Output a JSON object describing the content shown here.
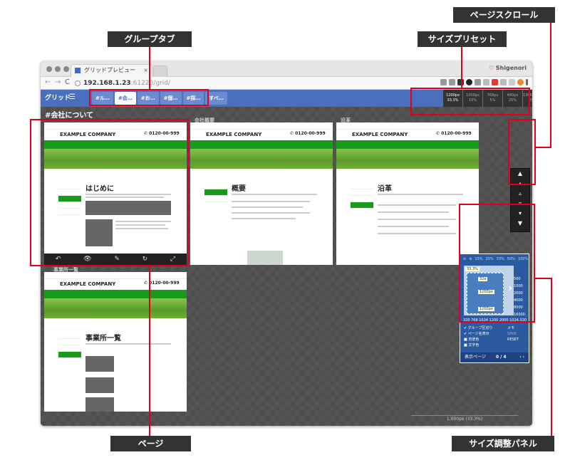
{
  "callouts": {
    "group_tab": "グループタブ",
    "size_preset": "サイズプリセット",
    "page_scroll": "ページスクロール",
    "page": "ページ",
    "size_panel": "サイズ調整パネル"
  },
  "browser": {
    "tab_title": "グリッドプレビュー",
    "tab_close": "×",
    "user": "Shigenori",
    "url_host": "192.168.1.23",
    "url_rest": ":61220/grid/",
    "back": "←",
    "forward": "→",
    "reload": "C"
  },
  "toolbar": {
    "grid_label": "グリッド",
    "list_icon": "☰",
    "group_tabs": [
      "#ル…",
      "#会…",
      "#お…",
      "#個…",
      "#採…",
      "すべ…"
    ],
    "active_group_index": 1,
    "presets": [
      {
        "label": "1200px",
        "sub": "33.3%"
      },
      {
        "label": "1000px",
        "sub": "15%"
      },
      {
        "label": "768px",
        "sub": "5%"
      },
      {
        "label": "480px",
        "sub": "25%"
      },
      {
        "label": "1366,320px",
        "sub": "25%"
      }
    ]
  },
  "section_title": "#会社について",
  "pages": [
    {
      "title": "",
      "heading": "はじめに"
    },
    {
      "title": "会社概要",
      "heading": "概要"
    },
    {
      "title": "沿革",
      "heading": "沿革"
    },
    {
      "title": "事業所一覧",
      "heading": "事業所一覧"
    }
  ],
  "company_name": "EXAMPLE COMPANY",
  "phone": "0120-00-999",
  "page_actions": [
    "↶",
    "👁",
    "✎",
    "↻",
    "⤢"
  ],
  "scroll_buttons": [
    "▲",
    "▴",
    "▵",
    "▿",
    "▾",
    "▼"
  ],
  "panel": {
    "zooms": [
      "15%",
      "25%",
      "33%",
      "50%",
      "100%"
    ],
    "ysizes": [
      "500",
      "1000",
      "2000",
      "4000",
      "8000",
      "16000"
    ],
    "xsizes": [
      "320",
      "768",
      "1024",
      "1200",
      "2000",
      "1024,320"
    ],
    "width_label": "1200px",
    "height_label": "1200px",
    "side_label": "32e",
    "zoom_label": "33.3%",
    "options": [
      "グループ区切り",
      "ページ名表示",
      "背景色",
      "文字色"
    ],
    "memo": "メモ",
    "save": "SAVE",
    "reset": "RESET",
    "page_label": "表示ページ",
    "page_count": "0 / 4"
  },
  "ruler_label": "1,000px (33.3%)"
}
